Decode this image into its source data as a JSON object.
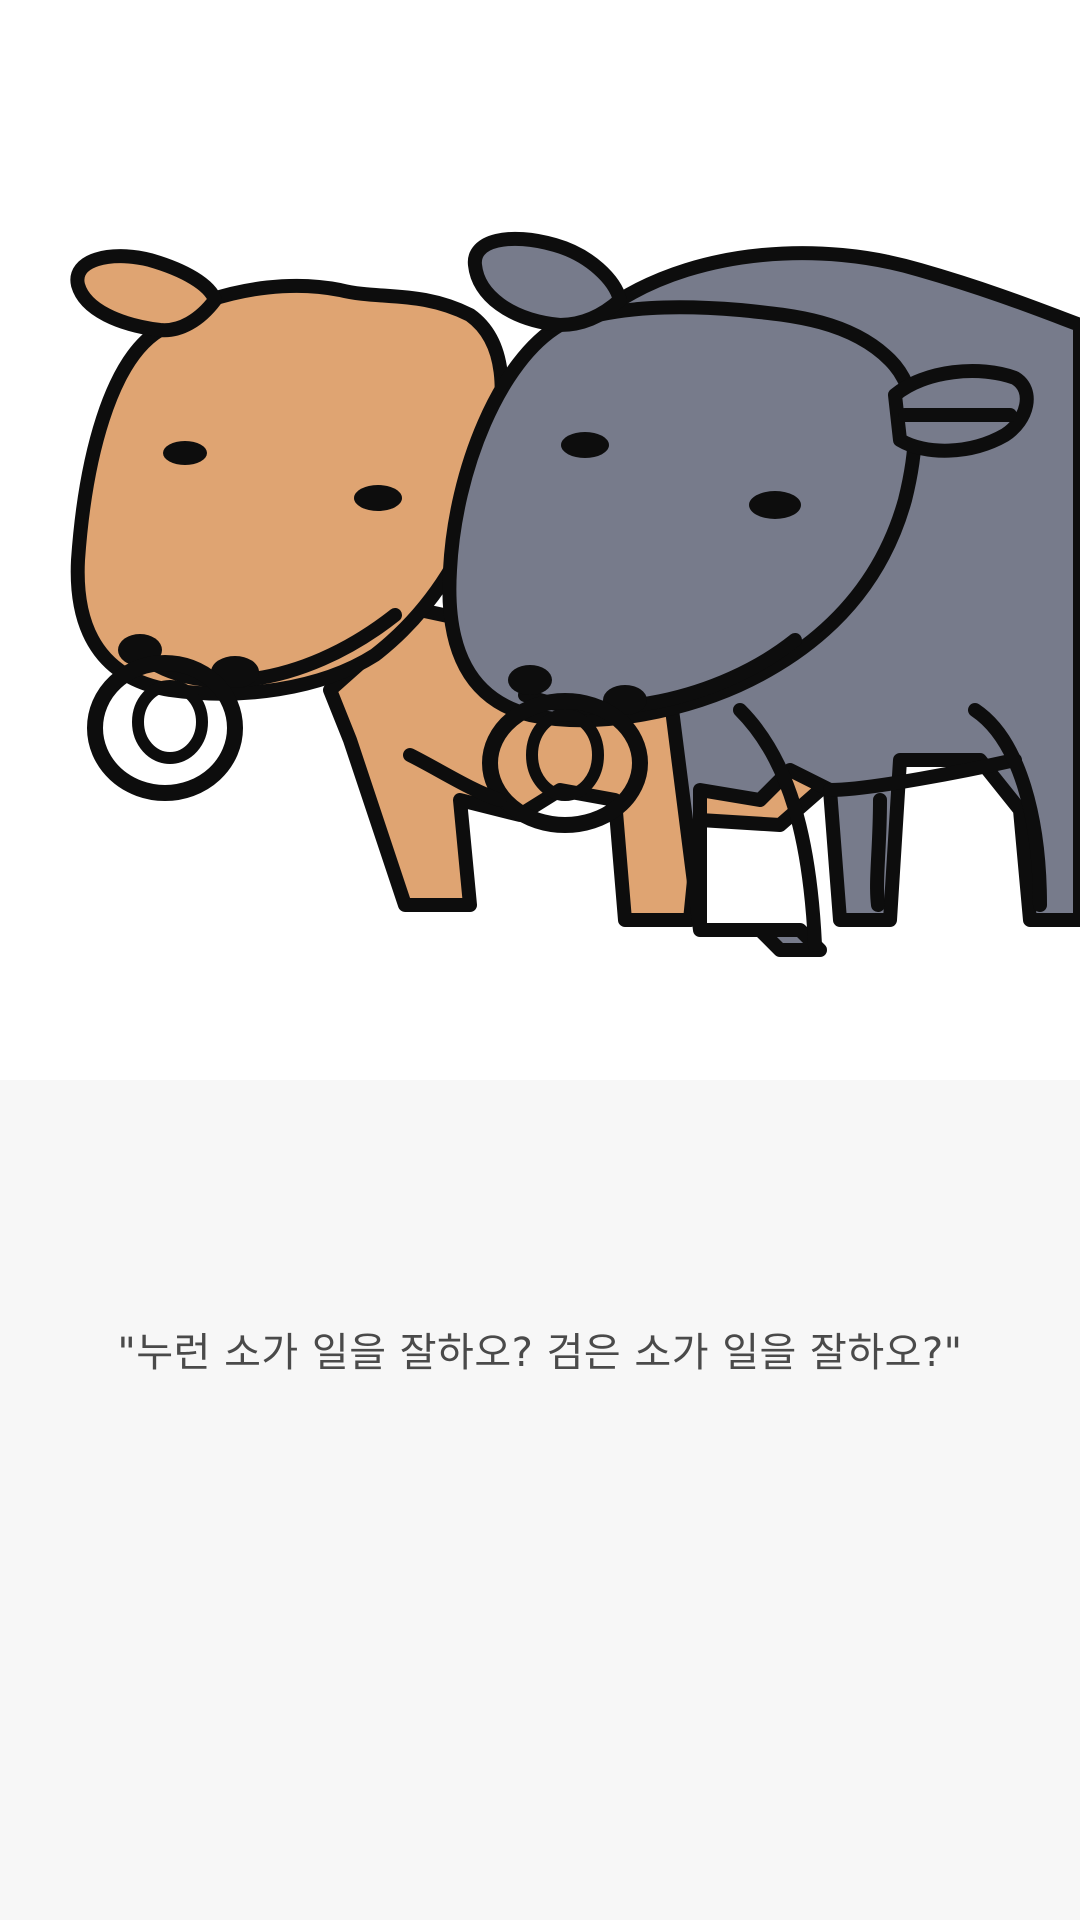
{
  "caption": "\"누런 소가 일을 잘하오? 검은 소가 일을 잘하오?\"",
  "colors": {
    "yellow_ox": "#dfa472",
    "black_ox": "#777b8b",
    "outline": "#0d0d0d",
    "illustration_bg": "#ffffff",
    "page_bg": "#f7f7f7",
    "caption_text": "#4a4a4a"
  },
  "illustration": {
    "figures": [
      "yellow-ox",
      "black-ox"
    ]
  }
}
